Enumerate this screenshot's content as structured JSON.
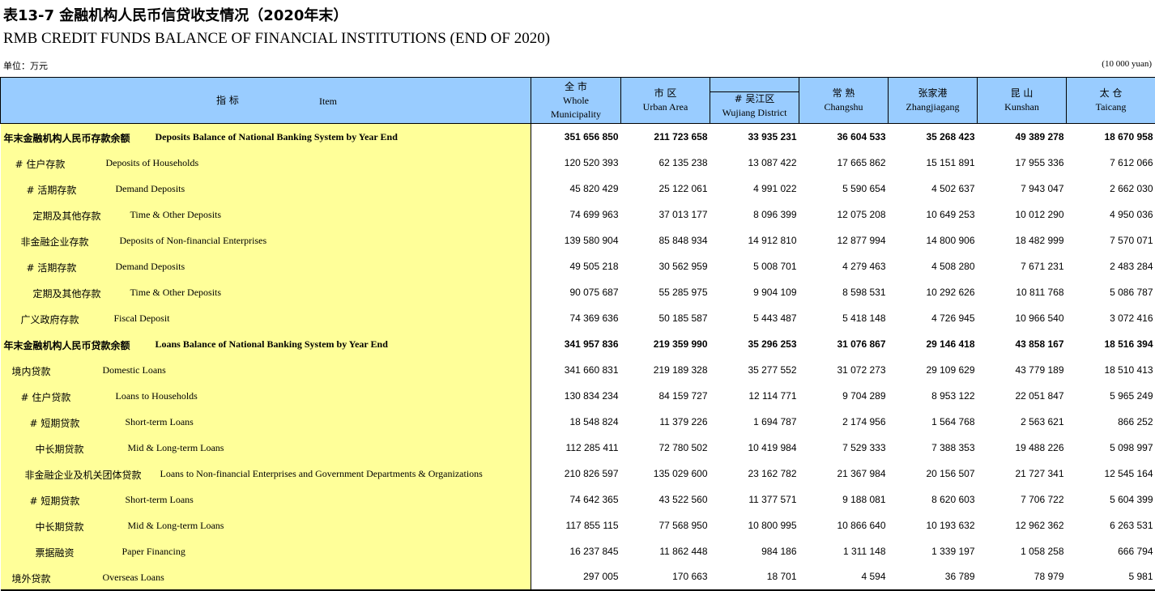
{
  "title_cn": "表13-7  金融机构人民币信贷收支情况（2020年末）",
  "title_en": "RMB CREDIT FUNDS BALANCE OF FINANCIAL INSTITUTIONS (END OF 2020)",
  "unit_cn": "单位：万元",
  "unit_en": "(10 000 yuan)",
  "header": {
    "item_cn": "指    标",
    "item_en": "Item",
    "columns": [
      {
        "cn": "全 市",
        "en1": "Whole",
        "en2": "Municipality"
      },
      {
        "cn": "市 区",
        "en1": "Urban Area",
        "en2": ""
      },
      {
        "cn": "# 吴江区",
        "en1": "Wujiang District",
        "en2": ""
      },
      {
        "cn": "常 熟",
        "en1": "Changshu",
        "en2": ""
      },
      {
        "cn": "张家港",
        "en1": "Zhangjiagang",
        "en2": ""
      },
      {
        "cn": "昆 山",
        "en1": "Kunshan",
        "en2": ""
      },
      {
        "cn": "太 仓",
        "en1": "Taicang",
        "en2": ""
      }
    ]
  },
  "rows": [
    {
      "cn": "年末金融机构人民币存款余额",
      "en": "Deposits Balance of National Banking System by Year End",
      "values": [
        "351 656 850",
        "211 723 658",
        "33 935 231",
        "36 604 533",
        "35 268 423",
        "49 389 278",
        "18 670 958"
      ]
    },
    {
      "cn": "# 住户存款",
      "en": "Deposits of Households",
      "values": [
        "120 520 393",
        "62 135 238",
        "13 087 422",
        "17 665 862",
        "15 151 891",
        "17 955 336",
        "7 612 066"
      ]
    },
    {
      "cn": "# 活期存款",
      "en": "Demand Deposits",
      "values": [
        "45 820 429",
        "25 122 061",
        "4 991 022",
        "5 590 654",
        "4 502 637",
        "7 943 047",
        "2 662 030"
      ]
    },
    {
      "cn": "定期及其他存款",
      "en": "Time & Other Deposits",
      "values": [
        "74 699 963",
        "37 013 177",
        "8 096 399",
        "12 075 208",
        "10 649 253",
        "10 012 290",
        "4 950 036"
      ]
    },
    {
      "cn": "非金融企业存款",
      "en": "Deposits of Non-financial Enterprises",
      "values": [
        "139 580 904",
        "85 848 934",
        "14 912 810",
        "12 877 994",
        "14 800 906",
        "18 482 999",
        "7 570 071"
      ]
    },
    {
      "cn": "# 活期存款",
      "en": "Demand Deposits",
      "values": [
        "49 505 218",
        "30 562 959",
        "5 008 701",
        "4 279 463",
        "4 508 280",
        "7 671 231",
        "2 483 284"
      ]
    },
    {
      "cn": "定期及其他存款",
      "en": "Time & Other Deposits",
      "values": [
        "90 075 687",
        "55 285 975",
        "9 904 109",
        "8 598 531",
        "10 292 626",
        "10 811 768",
        "5 086 787"
      ]
    },
    {
      "cn": "广义政府存款",
      "en": "Fiscal Deposit",
      "values": [
        "74 369 636",
        "50 185 587",
        "5 443 487",
        "5 418 148",
        "4 726 945",
        "10 966 540",
        "3 072 416"
      ]
    },
    {
      "cn": "年末金融机构人民币贷款余额",
      "en": "Loans Balance of National Banking System by Year End",
      "values": [
        "341 957 836",
        "219 359 990",
        "35 296 253",
        "31 076 867",
        "29 146 418",
        "43 858 167",
        "18 516 394"
      ]
    },
    {
      "cn": "境内贷款",
      "en": "Domestic Loans",
      "values": [
        "341 660 831",
        "219 189 328",
        "35 277 552",
        "31 072 273",
        "29 109 629",
        "43 779 189",
        "18 510 413"
      ]
    },
    {
      "cn": "# 住户贷款",
      "en": "Loans to Households",
      "values": [
        "130 834 234",
        "84 159 727",
        "12 114 771",
        "9 704 289",
        "8 953 122",
        "22 051 847",
        "5 965 249"
      ]
    },
    {
      "cn": "# 短期贷款",
      "en": "Short-term Loans",
      "values": [
        "18 548 824",
        "11 379 226",
        "1 694 787",
        "2 174 956",
        "1 564 768",
        "2 563 621",
        "866 252"
      ]
    },
    {
      "cn": "中长期贷款",
      "en": "Mid & Long-term Loans",
      "values": [
        "112 285 411",
        "72 780 502",
        "10 419 984",
        "7 529 333",
        "7 388 353",
        "19 488 226",
        "5 098 997"
      ]
    },
    {
      "cn": "非金融企业及机关团体贷款",
      "en": "Loans to Non-financial Enterprises and Government Departments & Organizations",
      "values": [
        "210 826 597",
        "135 029 600",
        "23 162 782",
        "21 367 984",
        "20 156 507",
        "21 727 341",
        "12 545 164"
      ]
    },
    {
      "cn": "# 短期贷款",
      "en": "Short-term Loans",
      "values": [
        "74 642 365",
        "43 522 560",
        "11 377 571",
        "9 188 081",
        "8 620 603",
        "7 706 722",
        "5 604 399"
      ]
    },
    {
      "cn": "中长期贷款",
      "en": "Mid & Long-term Loans",
      "values": [
        "117 855 115",
        "77 568 950",
        "10 800 995",
        "10 866 640",
        "10 193 632",
        "12 962 362",
        "6 263 531"
      ]
    },
    {
      "cn": "票据融资",
      "en": "Paper Financing",
      "values": [
        "16 237 845",
        "11 862 448",
        "984 186",
        "1 311 148",
        "1 339 197",
        "1 058 258",
        "666 794"
      ]
    },
    {
      "cn": "境外贷款",
      "en": "Overseas Loans",
      "values": [
        "297 005",
        "170 663",
        "18 701",
        "4 594",
        "36 789",
        "78 979",
        "5 981"
      ]
    }
  ]
}
